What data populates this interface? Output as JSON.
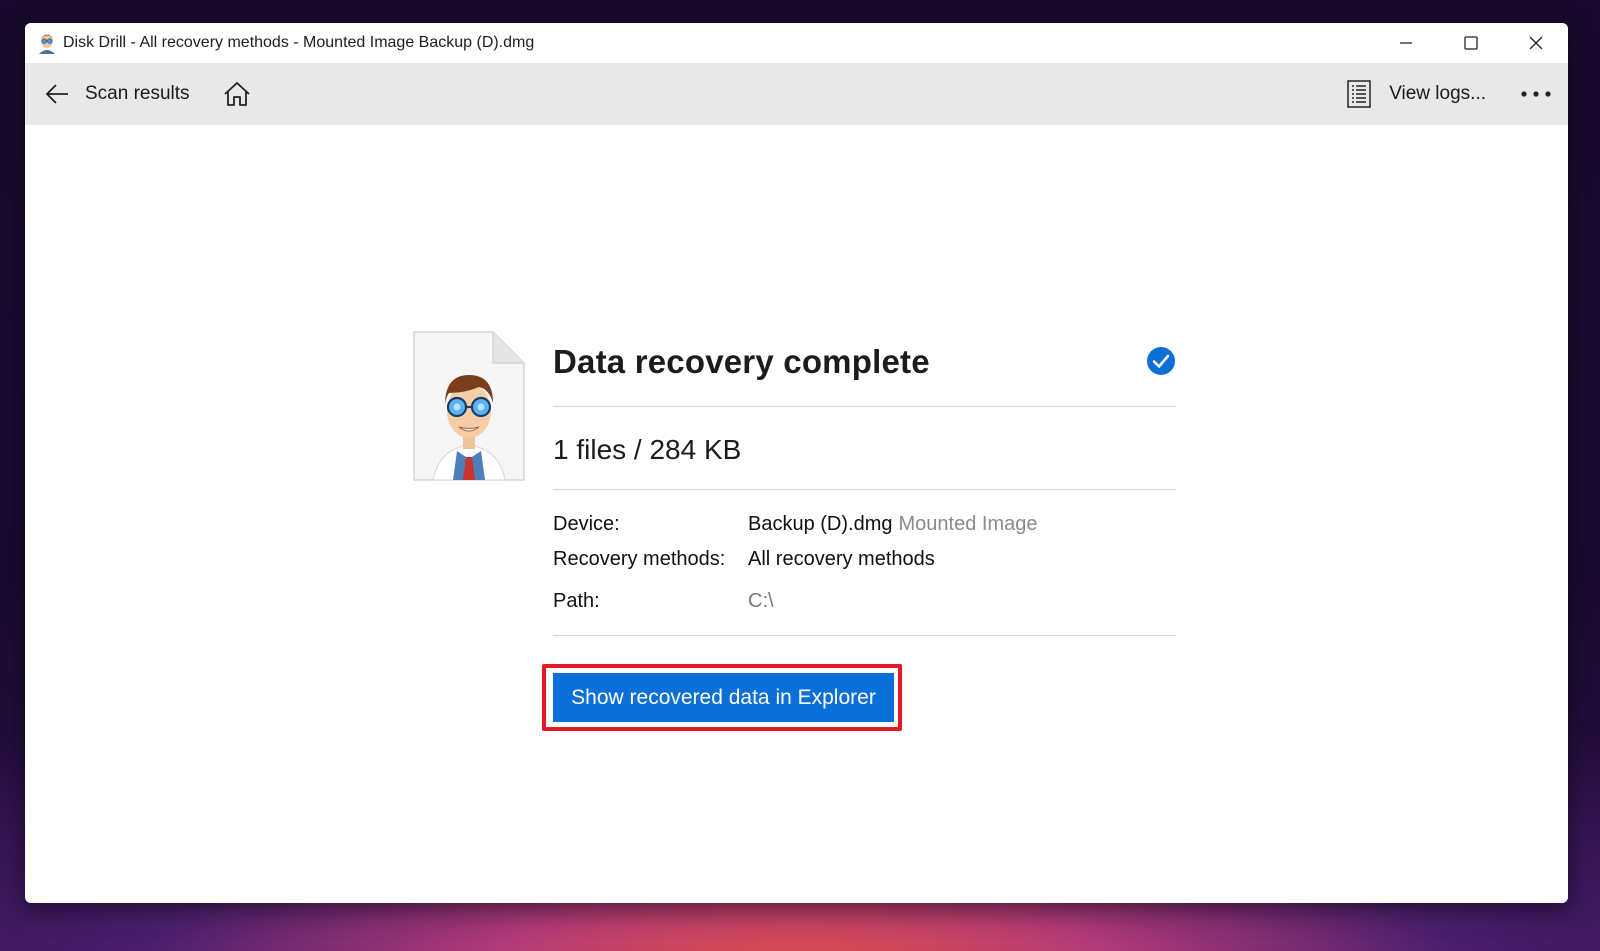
{
  "window": {
    "title": "Disk Drill - All recovery methods - Mounted Image Backup (D).dmg",
    "controls": [
      "minimize-icon",
      "maximize-icon",
      "close-icon"
    ]
  },
  "toolbar": {
    "back_label": "Scan results",
    "view_logs_label": "View logs...",
    "icons": [
      "arrow-left-icon",
      "home-icon",
      "logs-icon",
      "more-icon"
    ]
  },
  "result": {
    "heading": "Data recovery complete",
    "summary": "1 files / 284 KB",
    "details": [
      {
        "label": "Device:",
        "value": "Backup (D).dmg",
        "sub": "Mounted Image"
      },
      {
        "label": "Recovery methods:",
        "value": "All recovery methods"
      },
      {
        "label": "Path:",
        "value": "C:\\"
      }
    ],
    "action_label": "Show recovered data in Explorer"
  },
  "colors": {
    "accent": "#0a6fd7",
    "highlight": "#e01b24",
    "toolbar_bg": "#e8e8e8"
  }
}
